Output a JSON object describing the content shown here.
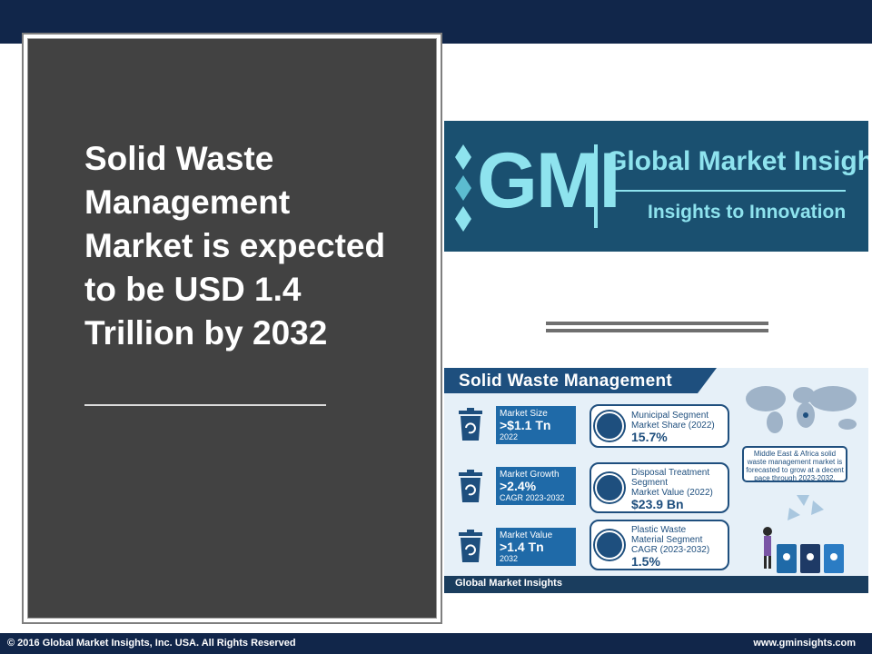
{
  "slide": {
    "headline": "Solid Waste Management Market is expected to be USD 1.4 Trillion by 2032"
  },
  "logo": {
    "mark": "GMI",
    "company": "Global Market Insights",
    "tagline": "Insights to Innovation",
    "color": "#8ee3ee",
    "background": "#1a5070"
  },
  "infographic": {
    "title": "Solid Waste Management",
    "stats": [
      {
        "label": "Market Size",
        "value": ">$1.1 Tn",
        "sub": "2022"
      },
      {
        "label": "Market Growth",
        "value": ">2.4%",
        "sub": "CAGR 2023-2032"
      },
      {
        "label": "Market Value",
        "value": ">1.4 Tn",
        "sub": "2032"
      }
    ],
    "segments": [
      {
        "label_lines": [
          "Municipal Segment",
          "Market Share (2022)"
        ],
        "value": "15.7%",
        "icon": "chart-icon"
      },
      {
        "label_lines": [
          "Disposal Treatment",
          "Segment",
          "Market Value (2022)"
        ],
        "value": "$23.9 Bn",
        "icon": "dollar-icon"
      },
      {
        "label_lines": [
          "Plastic Waste",
          "Material Segment",
          "CAGR (2023-2032)"
        ],
        "value": "1.5%",
        "icon": "monitor-chart-icon"
      }
    ],
    "regional_note": "Middle East & Africa solid waste management market is forecasted to grow at a decent pace through 2023-2032.",
    "footer_logo": "Global Market Insights",
    "accent": "#1f6aa8",
    "dark": "#1e4f7e"
  },
  "footer": {
    "copyright": "© 2016 Global Market Insights, Inc. USA.  All Rights Reserved",
    "website": "www.gminsights.com"
  },
  "colors": {
    "top_bar": "#11264a",
    "panel": "#424242"
  }
}
